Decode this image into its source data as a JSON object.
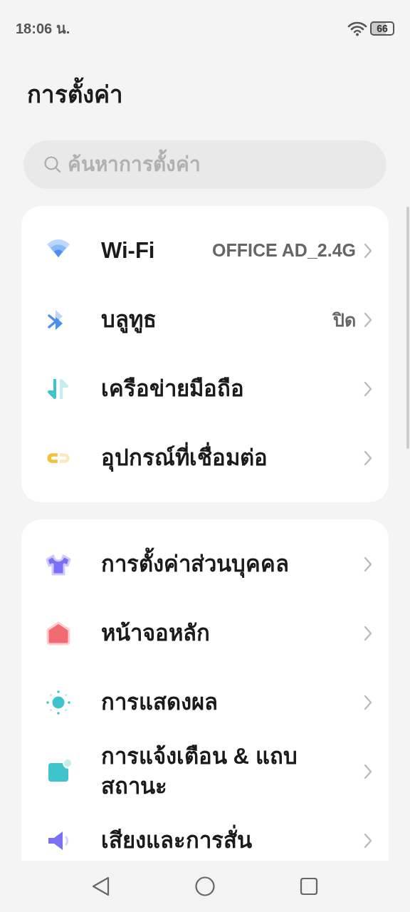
{
  "status_bar": {
    "time": "18:06 น.",
    "battery": "66"
  },
  "title": "การตั้งค่า",
  "search": {
    "placeholder": "ค้นหาการตั้งค่า"
  },
  "groups": [
    {
      "items": [
        {
          "label": "Wi-Fi",
          "value": "OFFICE AD_2.4G"
        },
        {
          "label": "บลูทูธ",
          "value": "ปิด"
        },
        {
          "label": "เครือข่ายมือถือ"
        },
        {
          "label": "อุปกรณ์ที่เชื่อมต่อ"
        }
      ]
    },
    {
      "items": [
        {
          "label": "การตั้งค่าส่วนบุคคล"
        },
        {
          "label": "หน้าจอหลัก"
        },
        {
          "label": "การแสดงผล"
        },
        {
          "label": "การแจ้งเตือน & แถบสถานะ"
        },
        {
          "label": "เสียงและการสั่น"
        }
      ]
    }
  ]
}
